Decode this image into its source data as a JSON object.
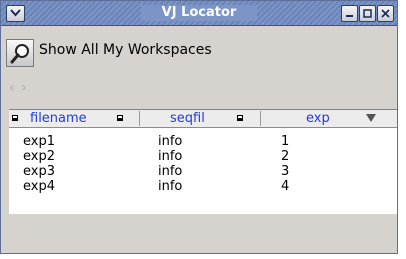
{
  "window": {
    "title": "VJ Locator",
    "controls": [
      "window-menu-icon",
      "minimize-icon",
      "maximize-icon",
      "close-icon"
    ]
  },
  "toolbar": {
    "find_icon": "magnifier-icon",
    "label": "Show All My Workspaces",
    "nav": {
      "back": "‹",
      "forward": "›"
    }
  },
  "table": {
    "columns": [
      {
        "label": "filename"
      },
      {
        "label": "seqfil"
      },
      {
        "label": "exp"
      }
    ],
    "sort": {
      "column": "exp",
      "direction": "descending"
    },
    "rows": [
      {
        "filename": "exp1",
        "seqfil": "info",
        "exp": "1"
      },
      {
        "filename": "exp2",
        "seqfil": "info",
        "exp": "2"
      },
      {
        "filename": "exp3",
        "seqfil": "info",
        "exp": "3"
      },
      {
        "filename": "exp4",
        "seqfil": "info",
        "exp": "4"
      }
    ]
  },
  "colors": {
    "titlebar": "#7c95c6",
    "header_text": "#1f3be0",
    "window_bg": "#d6d3ce"
  }
}
